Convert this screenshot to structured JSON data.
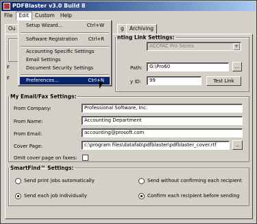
{
  "window": {
    "title": "PDFBlaster v3.0 Build 8"
  },
  "menubar": [
    "File",
    "Edit",
    "Custom",
    "Help"
  ],
  "edit_menu": {
    "items": [
      {
        "label": "Setup Wizard...",
        "shortcut": "Ctrl+W"
      },
      {
        "label": "Software Registration",
        "shortcut": "Ctrl+R"
      },
      {
        "label": "Accounting Specific Settings",
        "shortcut": ""
      },
      {
        "label": "Email Settings",
        "shortcut": ""
      },
      {
        "label": "Document Security Settings",
        "shortcut": ""
      },
      {
        "label": "Preferences...",
        "shortcut": "Ctrl+N"
      }
    ]
  },
  "tabs": [
    "Ou",
    "g",
    "Archiving"
  ],
  "accounting": {
    "legend": "nting Link Settings:",
    "product": "ACCPAC Pro Series",
    "path_label": "Path:",
    "path_value": "G:\\Pro60",
    "id_label": "y ID:",
    "id_value": "99",
    "test_button": "Test Link",
    "browse_button": "..."
  },
  "left_stubs": {
    "a": "F",
    "b": "F"
  },
  "email": {
    "legend": "My Email/Fax Settings:",
    "from_company_label": "From Company:",
    "from_company": "Professional Software, Inc.",
    "from_name_label": "From Name:",
    "from_name": "Accounting Department",
    "from_email_label": "From Email:",
    "from_email": "accounting@prosoft.com",
    "cover_page_label": "Cover Page:",
    "cover_page": "c:\\program files\\datafab\\pdfblaster\\pdfblaster_cover.rtf",
    "omit_label": "Omit cover page on faxes:",
    "browse_button": "..."
  },
  "smartfind": {
    "legend": "SmartFind™ Settings:",
    "opt1": "Send print jobs automatically",
    "opt2": "Send each job individually",
    "opt3": "Send without confirming each recipient",
    "opt4": "Confirm each recipient before sending"
  }
}
